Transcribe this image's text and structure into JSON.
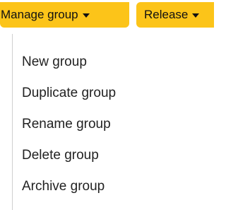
{
  "toolbar": {
    "manage_group_label": "Manage group",
    "release_label": "Release",
    "accent_color": "#fcc419"
  },
  "menu": {
    "items": [
      {
        "label": "New group"
      },
      {
        "label": "Duplicate group"
      },
      {
        "label": "Rename group"
      },
      {
        "label": "Delete group"
      },
      {
        "label": "Archive group"
      }
    ]
  }
}
